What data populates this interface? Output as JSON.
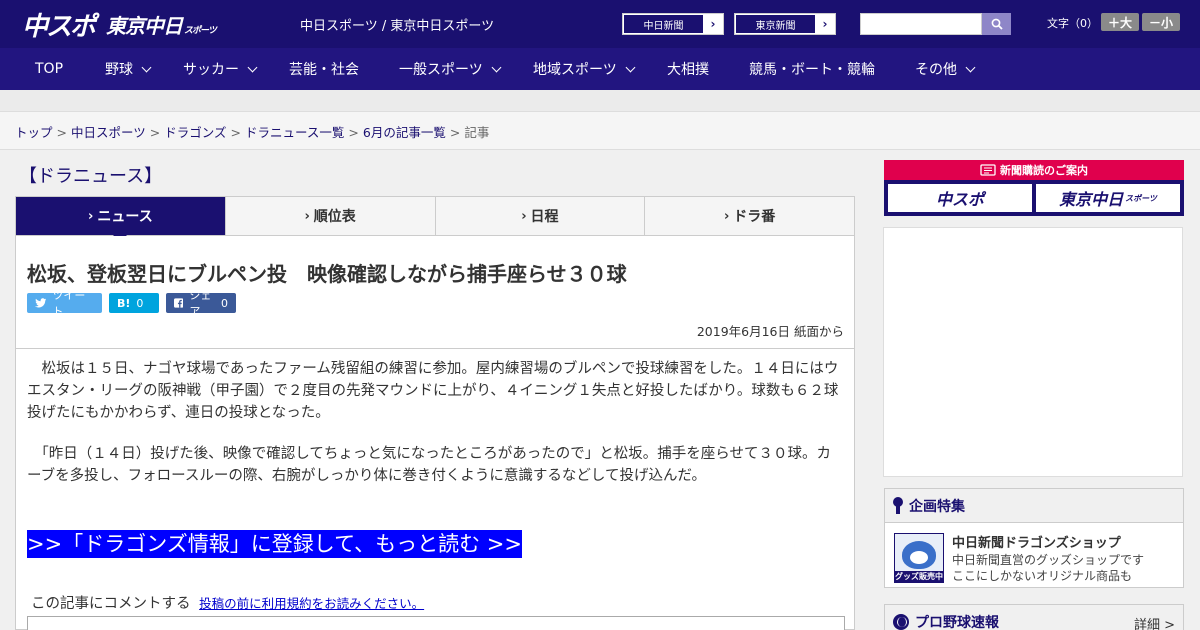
{
  "header": {
    "logo_main": "中スポ",
    "logo_tokyo": "東京中日",
    "logo_tokyo_sub": "スポーツ",
    "site_title": "中日スポーツ / 東京中日スポーツ",
    "paper_links": [
      {
        "label": "中日新聞",
        "arrow": "›"
      },
      {
        "label": "東京新聞",
        "arrow": "›"
      }
    ],
    "search_placeholder": "",
    "font_size_label": "文字（0）",
    "font_larger": "＋大",
    "font_smaller": "－小"
  },
  "nav": {
    "items": [
      {
        "label": "TOP",
        "has_menu": false
      },
      {
        "label": "野球",
        "has_menu": true
      },
      {
        "label": "サッカー",
        "has_menu": true
      },
      {
        "label": "芸能・社会",
        "has_menu": false
      },
      {
        "label": "一般スポーツ",
        "has_menu": true
      },
      {
        "label": "地域スポーツ",
        "has_menu": true
      },
      {
        "label": "大相撲",
        "has_menu": false
      },
      {
        "label": "競馬・ボート・競輪",
        "has_menu": false
      },
      {
        "label": "その他",
        "has_menu": true
      }
    ]
  },
  "breadcrumb": {
    "items": [
      "トップ",
      "中日スポーツ",
      "ドラゴンズ",
      "ドラニュース一覧",
      "6月の記事一覧"
    ],
    "current": "記事",
    "separator": ">"
  },
  "section": {
    "title": "【ドラニュース】"
  },
  "tabs": [
    {
      "label": "ニュース",
      "active": true
    },
    {
      "label": "順位表",
      "active": false
    },
    {
      "label": "日程",
      "active": false
    },
    {
      "label": "ドラ番",
      "active": false
    }
  ],
  "tab_arrow": "›",
  "article": {
    "headline": "松坂、登板翌日にブルペン投　映像確認しながら捕手座らせ３０球",
    "share": {
      "tweet": "ツイート",
      "hatena_label": "B!",
      "hatena_count": "0",
      "facebook": "シェア",
      "facebook_count": "0"
    },
    "dateline": "2019年6月16日 紙面から",
    "paragraphs": [
      "　松坂は１５日、ナゴヤ球場であったファーム残留組の練習に参加。屋内練習場のブルペンで投球練習をした。１４日にはウエスタン・リーグの阪神戦（甲子園）で２度目の先発マウンドに上がり、４イニング１失点と好投したばかり。球数も６２球投げたにもかかわらず、連日の投球となった。",
      "　「昨日（１４日）投げた後、映像で確認してちょっと気になったところがあったので」と松坂。捕手を座らせて３０球。カーブを多投し、フォロースルーの際、右腕がしっかり体に巻き付くように意識するなどして投げ込んだ。"
    ],
    "read_more": ">>「ドラゴンズ情報」に登録して、もっと読む >>",
    "comment_prompt": "この記事にコメントする",
    "comment_terms_link": "投稿の前に利用規約をお読みください。"
  },
  "sidebar": {
    "subscribe_title": "新聞購読のご案内",
    "subscribe_chuspo": "中スポ",
    "subscribe_tokyo": "東京中日",
    "subscribe_tokyo_sub": "スポーツ",
    "feature_title": "企画特集",
    "shop_title": "中日新聞ドラゴンズショップ",
    "shop_desc_1": "中日新聞直営のグッズショップです",
    "shop_desc_2": "ここにしかないオリジナル商品も",
    "shop_tag": "グッズ販売中",
    "baseball_title": "プロ野球速報",
    "detail_link": "詳細 >"
  },
  "colors": {
    "header_bg": "#1a1070",
    "nav_bg": "#221580",
    "read_more_bg": "#0000ff",
    "subscribe_red": "#e0004d"
  }
}
